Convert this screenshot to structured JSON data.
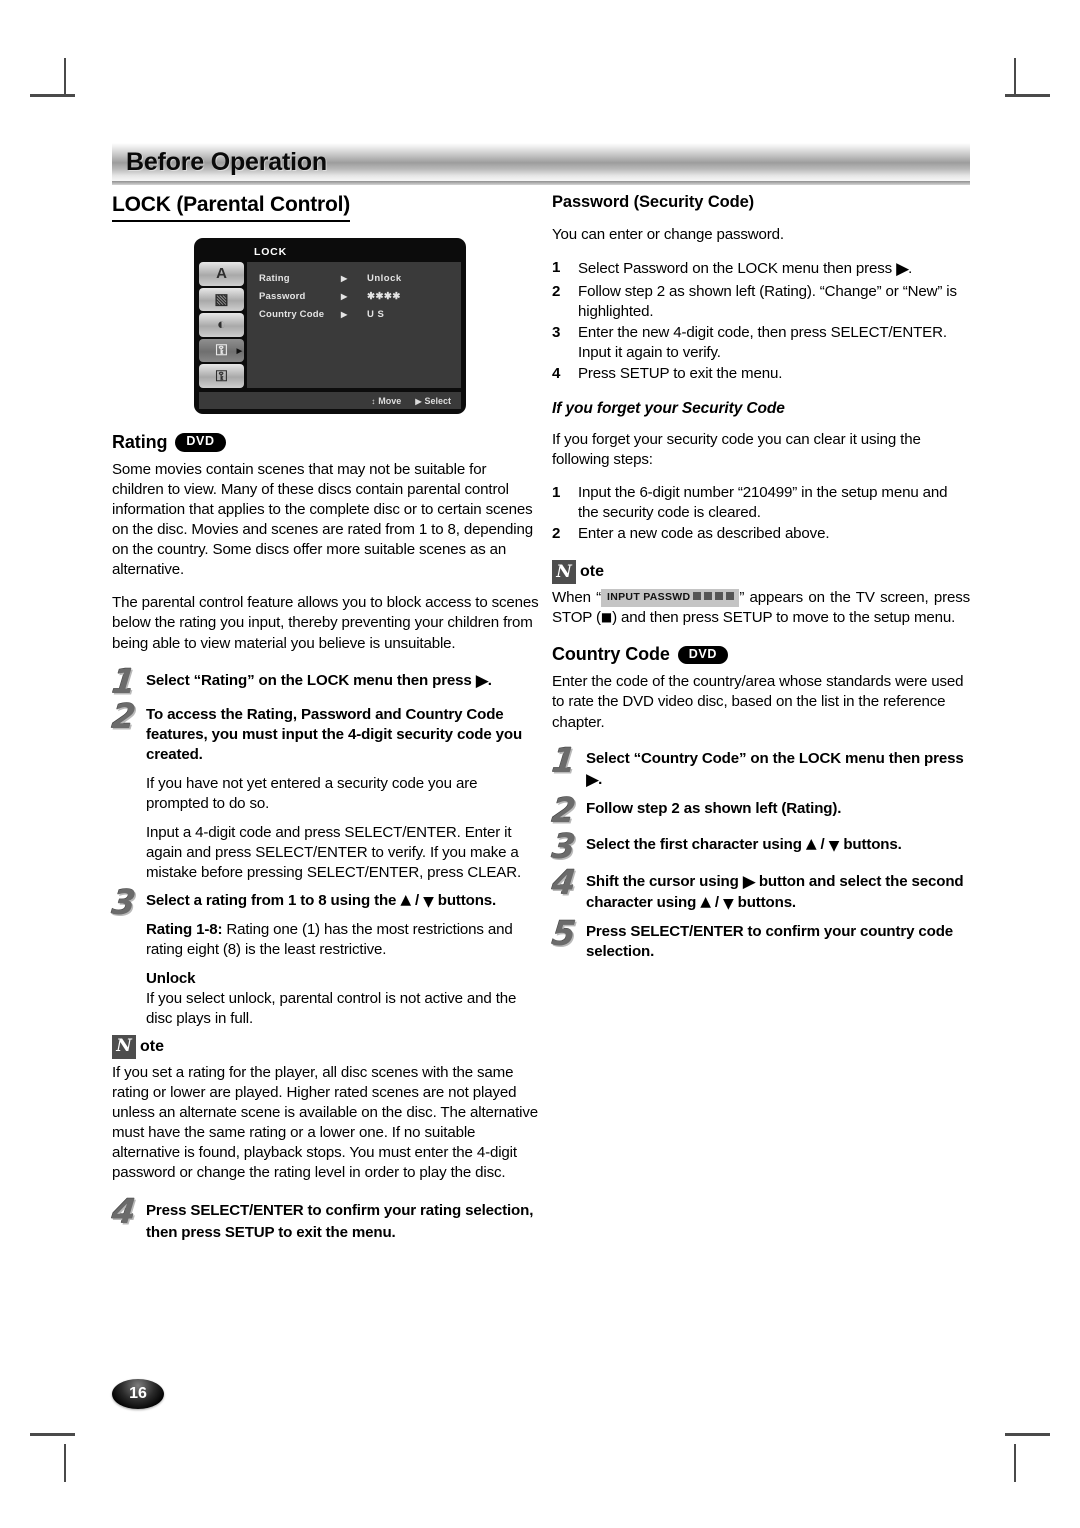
{
  "banner": {
    "title": "Before Operation"
  },
  "page": {
    "number": "16"
  },
  "left": {
    "heading": "LOCK (Parental Control)",
    "osd": {
      "title": "LOCK",
      "sidebar_icons": [
        {
          "name": "language-icon",
          "glyph": "A",
          "selected": false
        },
        {
          "name": "display-icon",
          "glyph": "▧",
          "selected": false
        },
        {
          "name": "audio-icon",
          "glyph": "◐",
          "selected": false
        },
        {
          "name": "lock-icon",
          "glyph": "⚿",
          "selected": true
        },
        {
          "name": "others-icon",
          "glyph": "⚿",
          "selected": false
        }
      ],
      "rows": [
        {
          "label": "Rating",
          "arrow": "▶",
          "value": "Unlock"
        },
        {
          "label": "Password",
          "arrow": "▶",
          "value": "✱✱✱✱"
        },
        {
          "label": "Country Code",
          "arrow": "▶",
          "value": "U S"
        }
      ],
      "footer": [
        {
          "icon": "↕",
          "label": "Move"
        },
        {
          "icon": "▶",
          "label": "Select"
        }
      ]
    },
    "rating": {
      "title": "Rating",
      "badge": "DVD",
      "para1": "Some movies contain scenes that may not be suitable for children to view. Many of these discs contain parental control information that applies to the complete disc or to certain scenes on the disc. Movies and scenes are rated from 1 to 8, depending on the country. Some discs offer more suitable scenes as an alternative.",
      "para2": "The parental control feature allows you to block access to scenes below the rating you input, thereby preventing your children from being able to view material you believe is unsuitable."
    },
    "steps": {
      "s1_num": "1",
      "s1_bold_a": "Select “Rating” on the LOCK menu then press",
      "s1_bold_b": ".",
      "s2_num": "2",
      "s2_bold": "To access the Rating, Password and Country Code features, you must input the 4-digit security code you created.",
      "s2_p1": "If you have not yet entered a security code you are prompted to do so.",
      "s2_p2": "Input a 4-digit code and press SELECT/ENTER. Enter it again and press SELECT/ENTER to verify. If you make a mistake before pressing SELECT/ENTER, press CLEAR.",
      "s3_num": "3",
      "s3_bold_a": "Select a rating from 1 to 8 using the",
      "s3_bold_b": "buttons.",
      "s3_rating_label": "Rating 1-8:",
      "s3_rating_text": " Rating one (1) has the most restrictions and rating eight (8) is the least restrictive.",
      "s3_unlock_head": "Unlock",
      "s3_unlock_text": "If you select unlock, parental control is not active and the disc plays in full.",
      "s4_num": "4",
      "s4_bold": "Press SELECT/ENTER to confirm your rating selection, then press SETUP to exit the menu."
    },
    "note": {
      "icon_letter": "N",
      "word": "ote",
      "text": " If you set a rating for the player, all disc scenes with the same rating or lower are played. Higher rated scenes are not played unless an alternate scene is available on the disc. The alternative must have the same rating or a lower one. If no suitable alternative is found, playback stops. You must enter the 4-digit password or change the rating level in order to play the disc."
    }
  },
  "right": {
    "password": {
      "title": "Password (Security Code)",
      "intro": "You can enter or change password.",
      "steps": [
        {
          "n": "1",
          "text_a": "Select Password on the LOCK menu then press",
          "text_b": "."
        },
        {
          "n": "2",
          "text_a": "Follow step 2 as shown left (Rating). “Change” or “New” is highlighted.",
          "text_b": ""
        },
        {
          "n": "3",
          "text_a": "Enter the new 4-digit code, then press SELECT/ENTER. Input it again to verify.",
          "text_b": ""
        },
        {
          "n": "4",
          "text_a": "Press SETUP to exit the menu.",
          "text_b": ""
        }
      ]
    },
    "forgot": {
      "title": "If you forget your Security Code",
      "intro": "If you forget your security code you can clear it using the following steps:",
      "steps": [
        {
          "n": "1",
          "text_a": "Input the 6-digit number “210499” in the setup menu and the security code is cleared.",
          "text_b": ""
        },
        {
          "n": "2",
          "text_a": "Enter a new code as described above.",
          "text_b": ""
        }
      ]
    },
    "note": {
      "icon_letter": "N",
      "word": "ote",
      "text_a": "When “",
      "chip_label": "INPUT PASSWD",
      "text_b": "” appears on the TV screen, press STOP (",
      "text_c": ") and then press SETUP to move to the setup menu."
    },
    "country": {
      "title": "Country Code",
      "badge": "DVD",
      "intro": "Enter the code of the country/area whose standards were used to rate the DVD video disc, based on the list in the reference chapter.",
      "s1_num": "1",
      "s1_bold_a": "Select “Country Code” on the LOCK menu then press",
      "s1_bold_b": ".",
      "s2_num": "2",
      "s2_bold": "Follow step 2 as shown left (Rating).",
      "s3_num": "3",
      "s3_bold_a": "Select the first character using",
      "s3_bold_b": "buttons.",
      "s4_num": "4",
      "s4_bold_a": "Shift the cursor using",
      "s4_bold_b": "button and select the second character using",
      "s4_bold_c": "buttons.",
      "s5_num": "5",
      "s5_bold": "Press SELECT/ENTER to confirm your country code selection."
    }
  },
  "glyphs": {
    "right": "▶",
    "up": "▲",
    "down": "▼",
    "stop": "■"
  }
}
